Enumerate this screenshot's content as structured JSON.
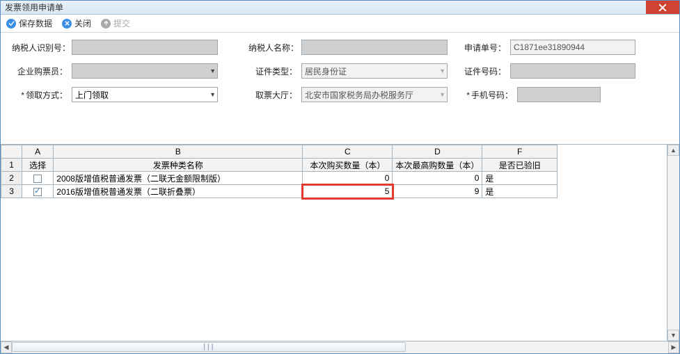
{
  "window": {
    "title": "发票领用申请单"
  },
  "toolbar": {
    "save_label": "保存数据",
    "close_label": "关闭",
    "submit_label": "提交"
  },
  "form": {
    "labels": {
      "nsrsbh": "纳税人识别号：",
      "nsrmc": "纳税人名称：",
      "sqdh": "申请单号：",
      "qygpy": "企业购票员：",
      "zjlx": "证件类型：",
      "zjhm": "证件号码：",
      "lqfs": "领取方式：",
      "qpdt": "取票大厅：",
      "sjhm": "手机号码：",
      "star": "*"
    },
    "values": {
      "sqdh": "C1871ee31890944",
      "zjlx": "居民身份证",
      "lqfs": "上门领取",
      "qpdt": "北安市国家税务局办税服务厅"
    }
  },
  "grid": {
    "colLetters": {
      "A": "A",
      "B": "B",
      "C": "C",
      "D": "D",
      "F": "F"
    },
    "headers": {
      "select": "选择",
      "name": "发票种类名称",
      "buyQty": "本次购买数量（本）",
      "maxQty": "本次最高购数量（本）",
      "verified": "是否已验旧"
    },
    "rowNumbers": {
      "r1": "1",
      "r2": "2",
      "r3": "3"
    },
    "rows": [
      {
        "checked": false,
        "name": "2008版增值税普通发票（二联无金额限制版）",
        "buy": "0",
        "max": "0",
        "verified": "是"
      },
      {
        "checked": true,
        "name": "2016版增值税普通发票（二联折叠票）",
        "buy": "5",
        "max": "9",
        "verified": "是"
      }
    ]
  }
}
